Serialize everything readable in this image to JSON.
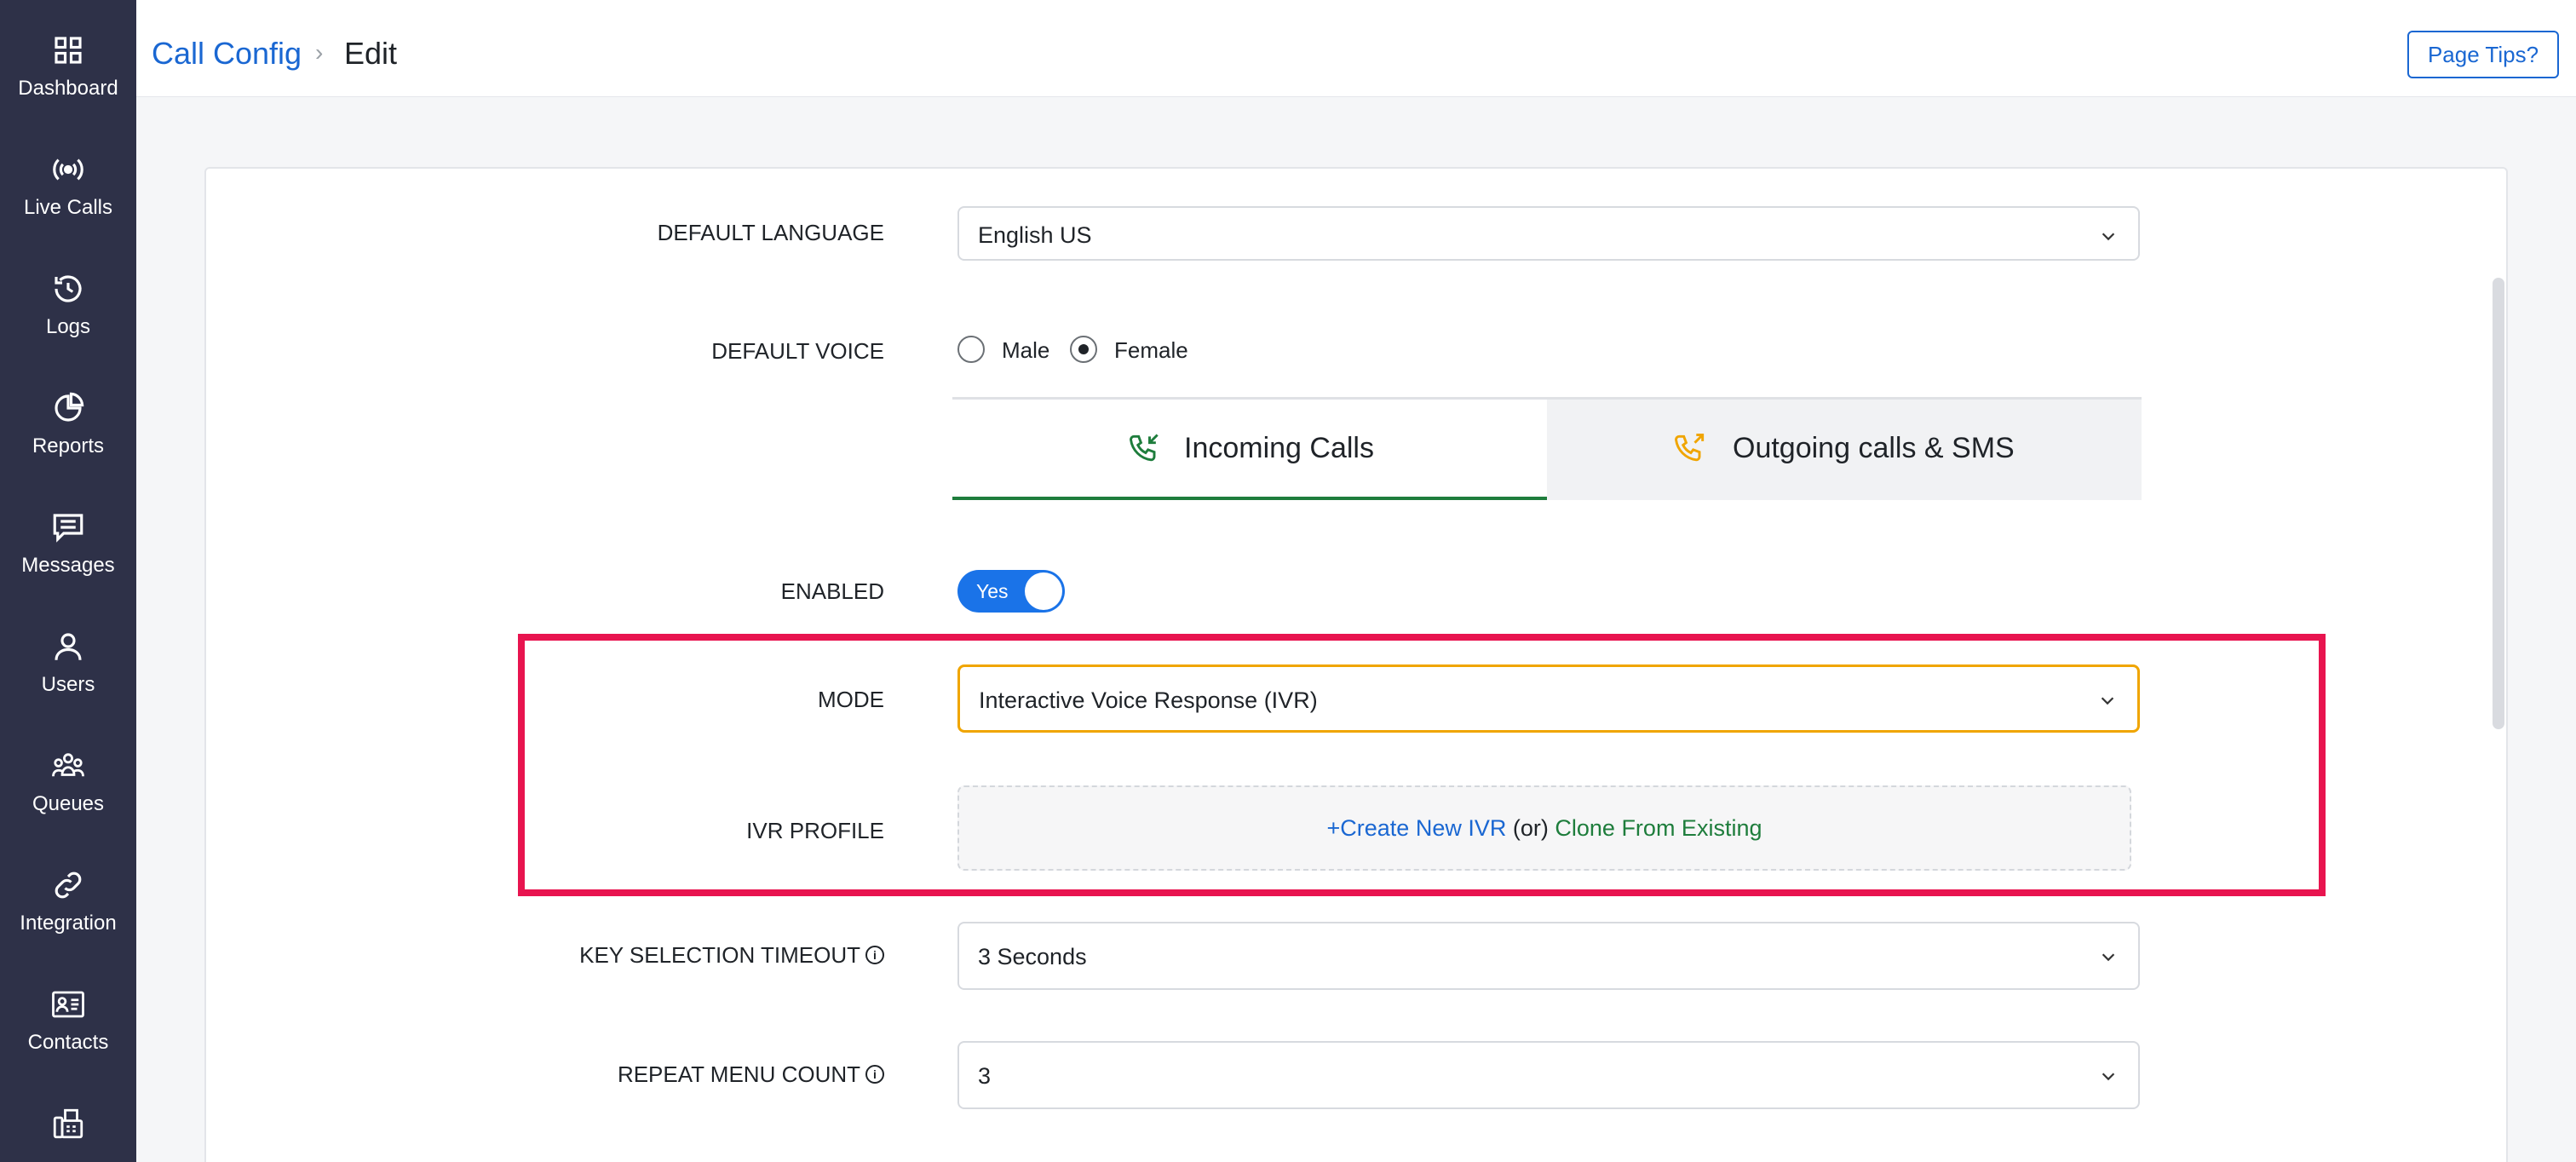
{
  "sidebar": {
    "items": [
      {
        "label": "Dashboard",
        "icon": "dashboard-grid-icon"
      },
      {
        "label": "Live Calls",
        "icon": "broadcast-icon"
      },
      {
        "label": "Logs",
        "icon": "history-icon"
      },
      {
        "label": "Reports",
        "icon": "pie-chart-icon"
      },
      {
        "label": "Messages",
        "icon": "message-icon"
      },
      {
        "label": "Users",
        "icon": "user-icon"
      },
      {
        "label": "Queues",
        "icon": "queue-people-icon"
      },
      {
        "label": "Integration",
        "icon": "link-icon"
      },
      {
        "label": "Contacts",
        "icon": "contact-card-icon"
      },
      {
        "label": "",
        "icon": "fax-icon"
      }
    ]
  },
  "header": {
    "breadcrumb_root": "Call Config",
    "breadcrumb_sep": "›",
    "breadcrumb_current": "Edit",
    "tips_button": "Page Tips?"
  },
  "form": {
    "default_language": {
      "label": "DEFAULT LANGUAGE",
      "value": "English US"
    },
    "default_voice": {
      "label": "DEFAULT VOICE",
      "options": [
        "Male",
        "Female"
      ],
      "selected": "Female"
    },
    "tabs": {
      "incoming": "Incoming Calls",
      "outgoing": "Outgoing calls & SMS",
      "active": "incoming"
    },
    "enabled": {
      "label": "ENABLED",
      "value": "Yes"
    },
    "mode": {
      "label": "MODE",
      "value": "Interactive Voice Response (IVR)"
    },
    "ivr_profile": {
      "label": "IVR PROFILE",
      "create": "+Create New IVR",
      "or": "(or)",
      "clone": "Clone From Existing"
    },
    "key_selection_timeout": {
      "label": "KEY SELECTION TIMEOUT",
      "value": "3 Seconds"
    },
    "repeat_menu_count": {
      "label": "REPEAT MENU COUNT",
      "value": "3"
    }
  },
  "colors": {
    "sidebar_bg": "#2e3148",
    "link_blue": "#1a67d2",
    "accent_green": "#1e7d3c",
    "highlight": "#e8144f",
    "focus_orange": "#f0a500",
    "toggle_blue": "#1a73e8"
  }
}
